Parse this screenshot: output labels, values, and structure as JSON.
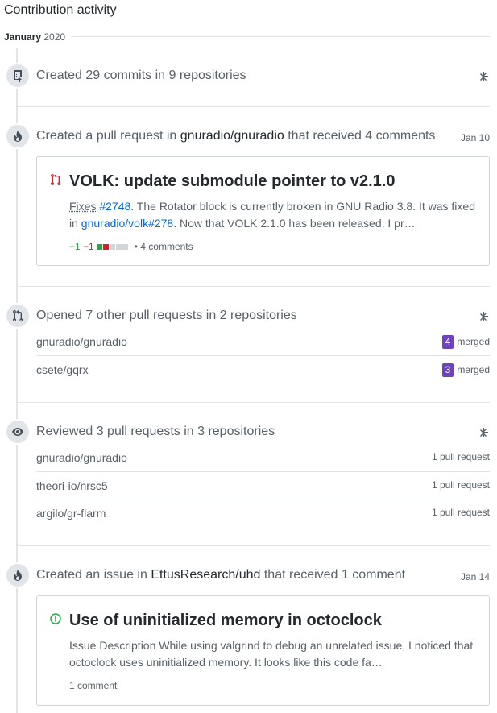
{
  "heading": "Contribution activity",
  "month": {
    "name": "January",
    "year": "2020"
  },
  "sections": {
    "commits": {
      "title": "Created 29 commits in 9 repositories"
    },
    "pr_created": {
      "prefix": "Created a pull request in",
      "repo": "gnuradio/gnuradio",
      "suffix": "that received 4 comments",
      "date": "Jan 10",
      "card": {
        "title": "VOLK: update submodule pointer to v2.1.0",
        "body_fixes": "Fixes",
        "body_ref1": "#2748",
        "body_text1": ". The Rotator block is currently broken in GNU Radio 3.8. It was fixed in",
        "body_ref2": "gnuradio/volk#278",
        "body_text2": ". Now that VOLK 2.1.0 has been released, I pr…",
        "additions": "+1",
        "deletions": "−1",
        "comments": "4 comments"
      }
    },
    "pr_opened": {
      "title": "Opened 7 other pull requests in 2 repositories",
      "rows": [
        {
          "repo": "gnuradio/gnuradio",
          "count": "4",
          "status": "merged"
        },
        {
          "repo": "csete/gqrx",
          "count": "3",
          "status": "merged"
        }
      ]
    },
    "reviewed": {
      "title": "Reviewed 3 pull requests in 3 repositories",
      "rows": [
        {
          "repo": "gnuradio/gnuradio",
          "label": "1 pull request"
        },
        {
          "repo": "theori-io/nrsc5",
          "label": "1 pull request"
        },
        {
          "repo": "argilo/gr-flarm",
          "label": "1 pull request"
        }
      ]
    },
    "issue": {
      "prefix": "Created an issue in",
      "repo": "EttusResearch/uhd",
      "suffix": "that received 1 comment",
      "date": "Jan 14",
      "card": {
        "title": "Use of uninitialized memory in octoclock",
        "body": "Issue Description While using valgrind to debug an unrelated issue, I noticed that octoclock uses uninitialized memory. It looks like this code fa…",
        "comments": "1 comment"
      }
    }
  },
  "colors": {
    "additions": "#28a745",
    "deletions": "#cb2431",
    "merged": "#6f42c1",
    "link": "#0366d6",
    "pr_icon": "#cb2431",
    "issue_icon": "#28a745"
  },
  "icons": [
    "repo-push-icon",
    "fold-icon",
    "flame-icon",
    "git-pull-request-icon",
    "eye-icon",
    "issue-opened-icon"
  ]
}
